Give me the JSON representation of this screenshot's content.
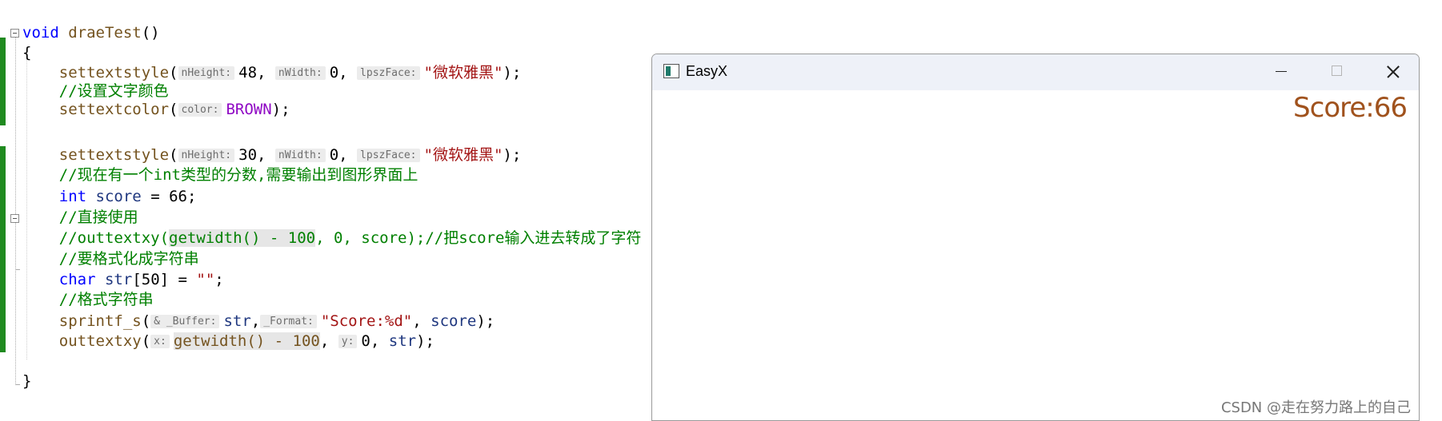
{
  "code": {
    "l1": {
      "kw": "void",
      "fn": "draeTest",
      "paren": "()"
    },
    "l2": {
      "brace": "{"
    },
    "l3": {
      "fn": "settextstyle",
      "open": "(",
      "h1": "nHeight:",
      "v1": "48",
      "s1": ", ",
      "h2": "nWidth:",
      "v2": "0",
      "s2": ", ",
      "h3": "lpszFace:",
      "str": "\"微软雅黑\"",
      "close": ");"
    },
    "l4": {
      "comment": "//设置文字颜色"
    },
    "l5": {
      "fn": "settextcolor",
      "open": "(",
      "h1": "color:",
      "mac": "BROWN",
      "close": ");"
    },
    "l6": {
      "fn": "settextstyle",
      "open": "(",
      "h1": "nHeight:",
      "v1": "30",
      "s1": ", ",
      "h2": "nWidth:",
      "v2": "0",
      "s2": ", ",
      "h3": "lpszFace:",
      "str": "\"微软雅黑\"",
      "close": ");"
    },
    "l7": {
      "comment": "//现在有一个int类型的分数,需要输出到图形界面上"
    },
    "l8": {
      "kw": "int",
      "var": "score",
      "rest": " = 66;"
    },
    "l9": {
      "comment": "//直接使用"
    },
    "l10": {
      "c1": "//outtextxy(",
      "c2": "getwidth() - 100",
      "c3": ", 0, score);//把score输入进去转成了字符"
    },
    "l11": {
      "comment": "//要格式化成字符串"
    },
    "l12": {
      "kw": "char",
      "var": "str",
      "mid": "[50] = ",
      "str": "\"\"",
      "end": ";"
    },
    "l13": {
      "comment": "//格式字符串"
    },
    "l14": {
      "fn": "sprintf_s",
      "open": "(",
      "h1": "& _Buffer:",
      "var1": "str",
      "s1": ",",
      "h2": "_Format:",
      "str": "\"Score:%d\"",
      "s2": ", ",
      "var2": "score",
      "close": ");"
    },
    "l15": {
      "fn": "outtextxy",
      "open": "(",
      "h1": "x:",
      "expr": "getwidth() - 100",
      "s1": ", ",
      "h2": "y:",
      "v2": "0",
      "s2": ", ",
      "var2": "str",
      "close": ");"
    },
    "l16": {
      "brace": "}"
    }
  },
  "window": {
    "title": "EasyX",
    "output_text": "Score:66"
  },
  "watermark": "CSDN @走在努力路上的自己",
  "colors": {
    "change_bar": "#1f8a1f",
    "output_text": "#a0521d",
    "keyword": "#0000ff",
    "comment": "#008000"
  }
}
